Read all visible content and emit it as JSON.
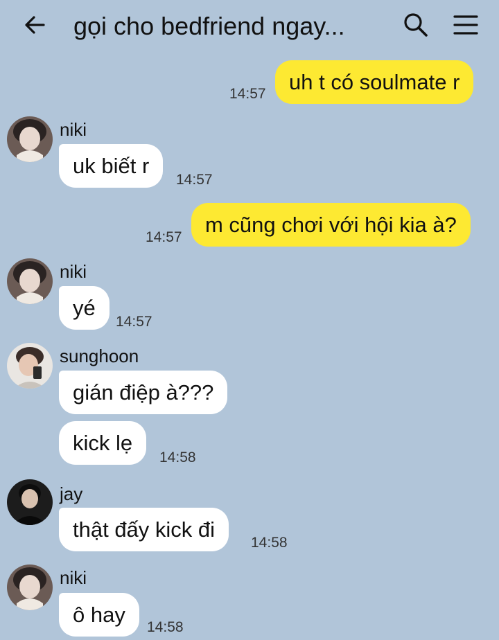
{
  "header": {
    "title": "gọi cho bedfriend ngay...",
    "back_icon": "arrow-left-icon",
    "search_icon": "search-icon",
    "menu_icon": "hamburger-menu-icon"
  },
  "messages": [
    {
      "direction": "out",
      "text": "uh t có soulmate r",
      "time": "14:57"
    },
    {
      "direction": "in",
      "sender": "niki",
      "text": "uk biết r",
      "time": "14:57"
    },
    {
      "direction": "out",
      "text": "m cũng chơi với hội kia à?",
      "time": "14:57"
    },
    {
      "direction": "in",
      "sender": "niki",
      "text": "yé",
      "time": "14:57"
    },
    {
      "direction": "in",
      "sender": "sunghoon",
      "text": "gián điệp à???",
      "time": ""
    },
    {
      "direction": "in",
      "sender": "sunghoon",
      "text": "kick lẹ",
      "time": "14:58"
    },
    {
      "direction": "in",
      "sender": "jay",
      "text": "thật đấy kick đi",
      "time": "14:58"
    },
    {
      "direction": "in",
      "sender": "niki",
      "text": "ô hay",
      "time": "14:58"
    }
  ],
  "colors": {
    "background": "#b1c5d9",
    "outgoing_bubble": "#fde932",
    "incoming_bubble": "#ffffff"
  }
}
